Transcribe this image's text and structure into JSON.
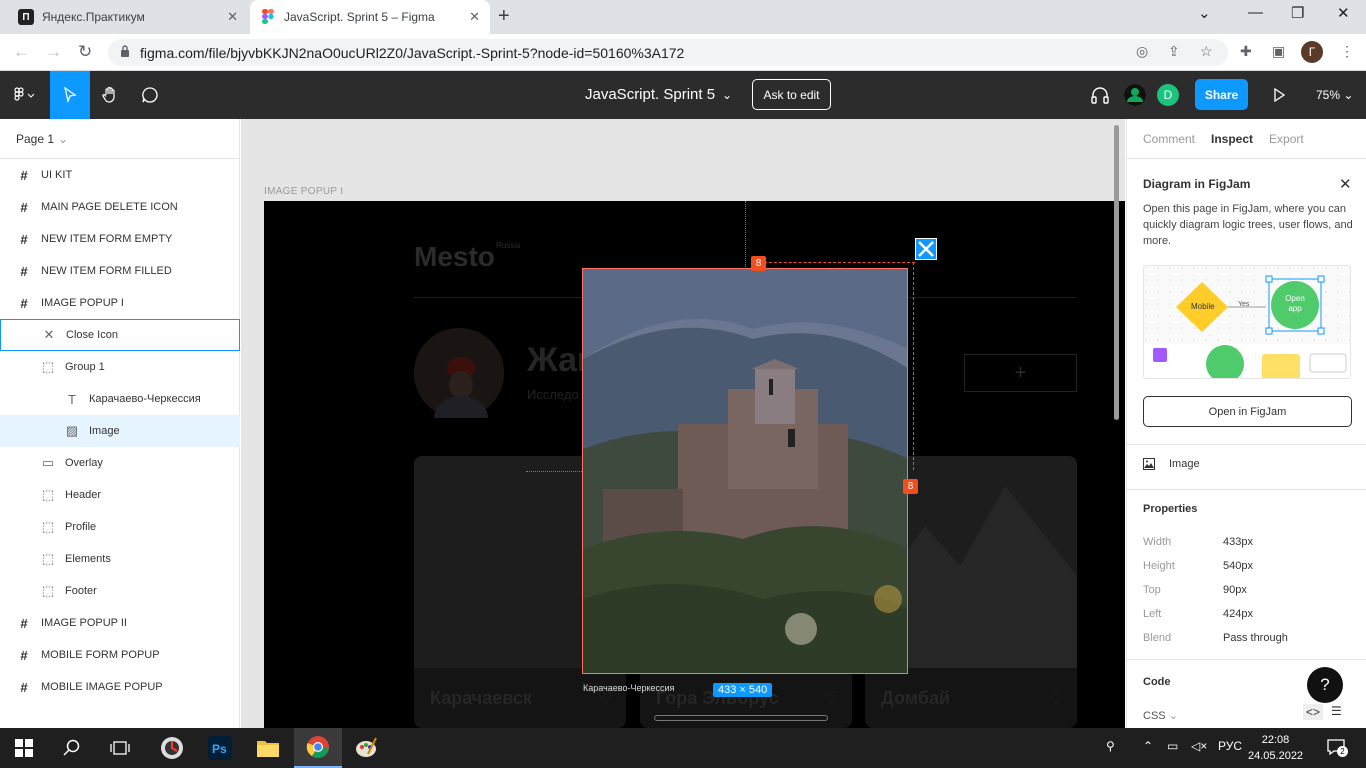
{
  "browser": {
    "tabs": [
      {
        "title": "Яндекс.Практикум",
        "active": false
      },
      {
        "title": "JavaScript. Sprint 5 – Figma",
        "active": true
      }
    ],
    "url": "figma.com/file/bjyvbKKJN2naO0ucURl2Z0/JavaScript.-Sprint-5?node-id=50160%3A172",
    "profile_initial": "Г"
  },
  "figma": {
    "doc_title": "JavaScript. Sprint 5",
    "ask_to_edit": "Ask to edit",
    "share": "Share",
    "avatar_initial": "D",
    "zoom": "75%"
  },
  "layers": {
    "page": "Page 1",
    "items": [
      {
        "label": "UI KIT",
        "icon": "frame-icon",
        "level": 0
      },
      {
        "label": "MAIN PAGE DELETE ICON",
        "icon": "frame-icon",
        "level": 0
      },
      {
        "label": "NEW ITEM FORM EMPTY",
        "icon": "frame-icon",
        "level": 0
      },
      {
        "label": "NEW ITEM FORM FILLED",
        "icon": "frame-icon",
        "level": 0
      },
      {
        "label": "IMAGE POPUP I",
        "icon": "frame-icon",
        "level": 0
      },
      {
        "label": "Close Icon",
        "icon": "close-icon",
        "level": 1,
        "state": "hover"
      },
      {
        "label": "Group 1",
        "icon": "group-icon",
        "level": 1
      },
      {
        "label": "Карачаево-Черкессия",
        "icon": "text-icon",
        "level": 2
      },
      {
        "label": "Image",
        "icon": "image-icon",
        "level": 2,
        "state": "selected"
      },
      {
        "label": "Overlay",
        "icon": "rectangle-icon",
        "level": 1
      },
      {
        "label": "Header",
        "icon": "group-icon",
        "level": 1
      },
      {
        "label": "Profile",
        "icon": "group-icon",
        "level": 1
      },
      {
        "label": "Elements",
        "icon": "group-icon",
        "level": 1
      },
      {
        "label": "Footer",
        "icon": "group-icon",
        "level": 1
      },
      {
        "label": "IMAGE POPUP II",
        "icon": "frame-icon",
        "level": 0
      },
      {
        "label": "MOBILE FORM POPUP",
        "icon": "frame-icon",
        "level": 0
      },
      {
        "label": "MOBILE IMAGE POPUP",
        "icon": "frame-icon",
        "level": 0
      }
    ]
  },
  "canvas": {
    "frame_label": "IMAGE POPUP I",
    "logo": "Mesto",
    "logo_sup": "Russia",
    "profile_name": "Жак",
    "profile_sub": "Исследо",
    "cards": [
      "Карачаевск",
      "Гора Эльбрус",
      "Домбай"
    ],
    "caption": "Карачаево-Черкессия",
    "dimensions": "433 × 540",
    "spacing_top": "8",
    "spacing_right": "8"
  },
  "inspect": {
    "tabs": [
      "Comment",
      "Inspect",
      "Export"
    ],
    "active_tab": "Inspect",
    "figjam_title": "Diagram in FigJam",
    "figjam_desc": "Open this page in FigJam, where you can quickly diagram logic trees, user flows, and more.",
    "figjam_preview": {
      "node1": "Mobile",
      "edge": "Yes",
      "node2": "Open app"
    },
    "open_figjam": "Open in FigJam",
    "selection": "Image",
    "properties_heading": "Properties",
    "properties": [
      {
        "label": "Width",
        "value": "433px"
      },
      {
        "label": "Height",
        "value": "540px"
      },
      {
        "label": "Top",
        "value": "90px"
      },
      {
        "label": "Left",
        "value": "424px"
      },
      {
        "label": "Blend",
        "value": "Pass through"
      }
    ],
    "code_heading": "Code",
    "code_lang": "CSS",
    "help": "?"
  },
  "taskbar": {
    "lang": "РУС",
    "time": "22:08",
    "date": "24.05.2022",
    "notifications": "2"
  }
}
